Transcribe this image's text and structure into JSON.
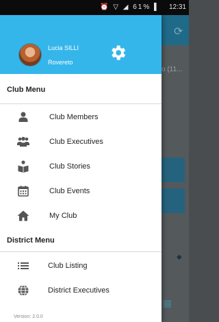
{
  "status_bar": {
    "icons": "⏰ ▽ ◢ ▌",
    "battery_label": "61%",
    "time": "12:31"
  },
  "background": {
    "list_text_fragment": "o (11..."
  },
  "drawer": {
    "user": {
      "name": "Lucia SILLI",
      "city": "Rovereto"
    },
    "club_menu_title": "Club Menu",
    "club_items": [
      {
        "label": "Club Members",
        "icon": "person-icon"
      },
      {
        "label": "Club Executives",
        "icon": "group-icon"
      },
      {
        "label": "Club Stories",
        "icon": "book-reader-icon"
      },
      {
        "label": "Club Events",
        "icon": "calendar-icon"
      },
      {
        "label": "My Club",
        "icon": "home-icon"
      }
    ],
    "district_menu_title": "District Menu",
    "district_items": [
      {
        "label": "Club Listing",
        "icon": "list-icon"
      },
      {
        "label": "District Executives",
        "icon": "globe-icon"
      }
    ],
    "version": "Version: 2.0.0"
  },
  "colors": {
    "header": "#35b6eb",
    "toolbar_bg": "#1f6a88",
    "icon_gray": "#555555"
  }
}
